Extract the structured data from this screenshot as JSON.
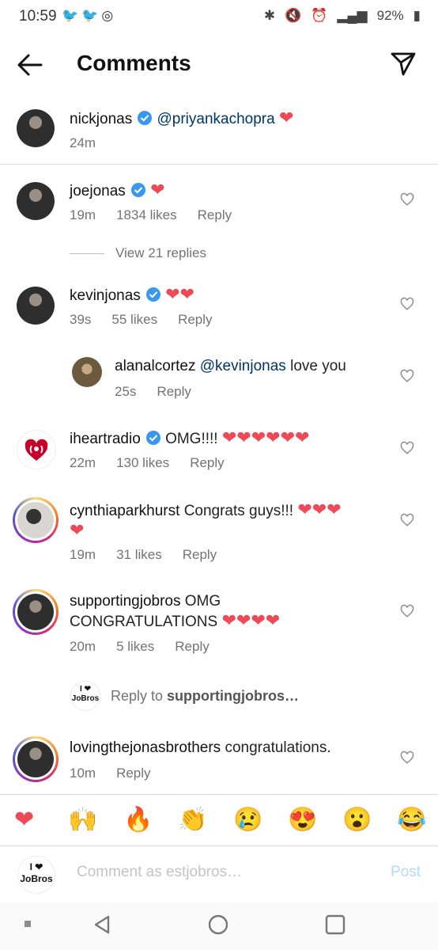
{
  "status": {
    "time": "10:59",
    "battery": "92%"
  },
  "header": {
    "title": "Comments"
  },
  "caption": {
    "user": "nickjonas",
    "mention": "@priyankachopra",
    "emoji": "❤",
    "time": "24m"
  },
  "comments": [
    {
      "user": "joejonas",
      "text": "",
      "emoji": "❤",
      "time": "19m",
      "likes": "1834 likes",
      "reply": "Reply"
    },
    {
      "view_replies": "View 21 replies"
    },
    {
      "user": "kevinjonas",
      "text": "",
      "emoji": "❤❤",
      "time": "39s",
      "likes": "55 likes",
      "reply": "Reply"
    },
    {
      "user": "alanalcortez",
      "mention": "@kevinjonas",
      "text": " love you",
      "time": "25s",
      "reply": "Reply"
    },
    {
      "user": "iheartradio",
      "text": "OMG!!!!",
      "emoji": "❤❤❤❤❤❤",
      "time": "22m",
      "likes": "130 likes",
      "reply": "Reply"
    },
    {
      "user": "cynthiaparkhurst",
      "text": "Congrats guys!!!",
      "emoji": "❤❤❤",
      "emoji2": "❤",
      "time": "19m",
      "likes": "31 likes",
      "reply": "Reply"
    },
    {
      "user": "supportingjobros",
      "text": "OMG",
      "text2": "CONGRATULATIONS",
      "emoji": "❤❤❤❤",
      "time": "20m",
      "likes": "5 likes",
      "reply": "Reply"
    },
    {
      "user": "lovingthejonasbrothers",
      "text": "congratulations.",
      "time": "10m",
      "reply": "Reply"
    }
  ],
  "reply_to": {
    "prefix": "Reply to ",
    "user": "supportingjobros…"
  },
  "emoji_bar": [
    "❤",
    "🙌",
    "🔥",
    "👏",
    "😢",
    "😍",
    "😮",
    "😂"
  ],
  "composer": {
    "placeholder": "Comment as estjobros…",
    "post": "Post",
    "logo_top": "I ❤",
    "logo_bottom": "JoBros"
  },
  "colors": {
    "heart": "#ed4956",
    "link": "#003569",
    "verified": "#3897f0",
    "post": "#b3dbff"
  }
}
